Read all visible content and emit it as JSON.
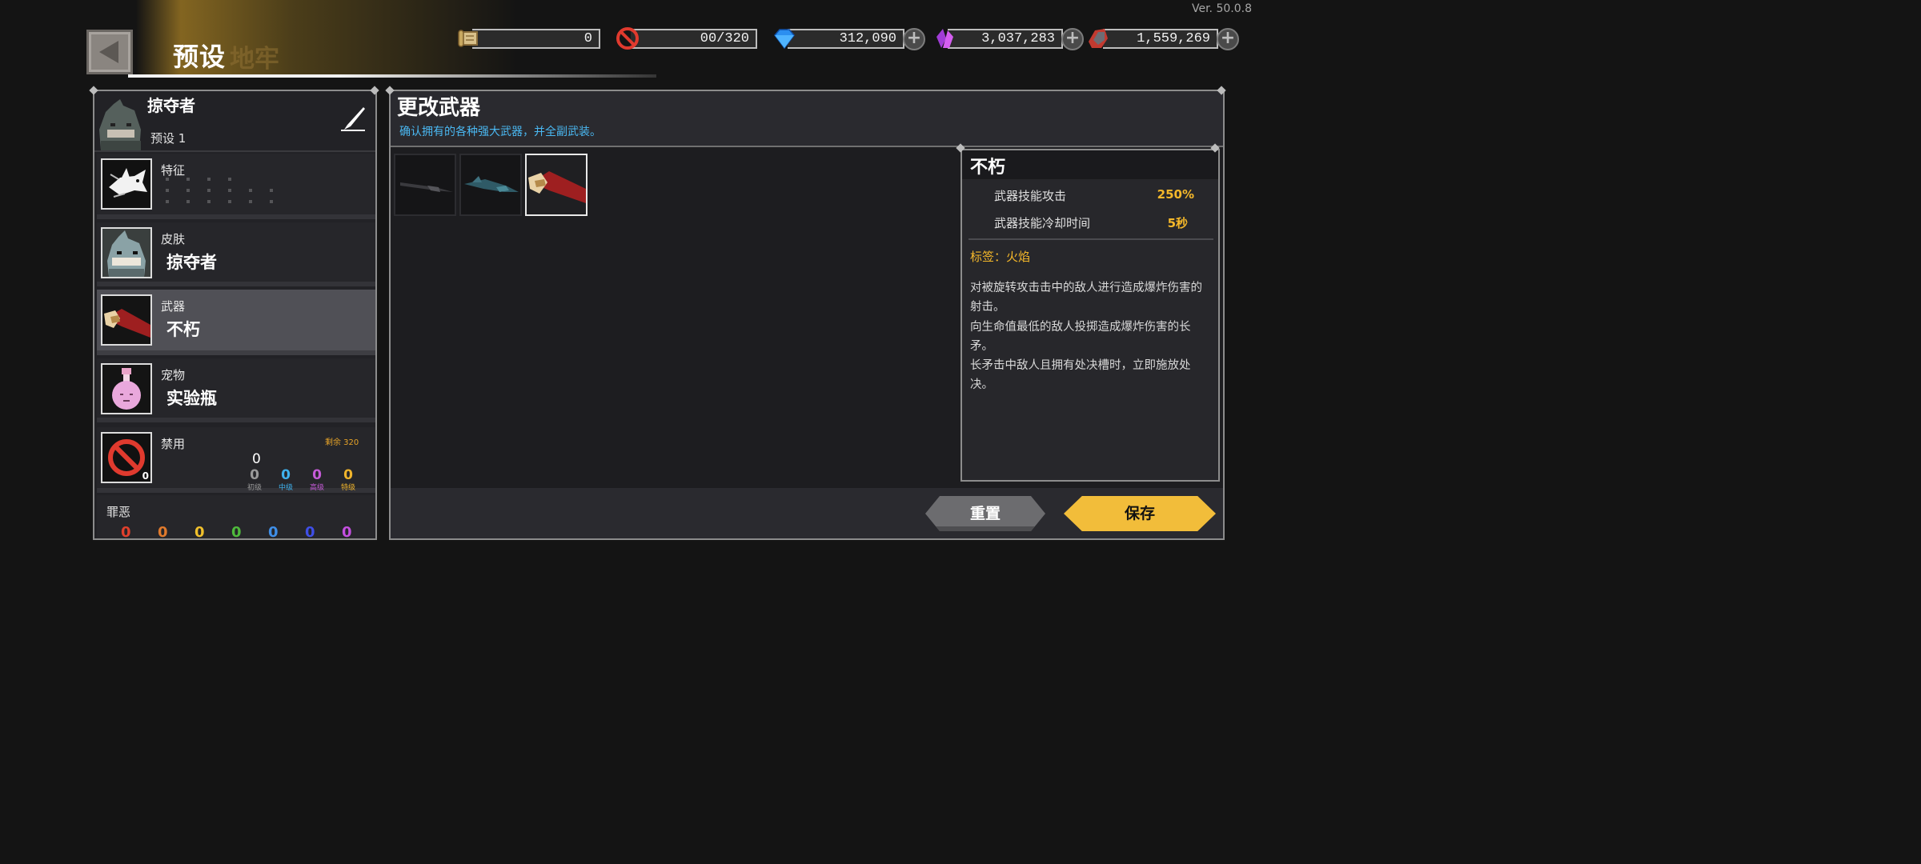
{
  "version": "Ver. 50.0.8",
  "header": {
    "title": "预设",
    "ghost_title": "地牢"
  },
  "resources": [
    {
      "icon": "scroll-icon",
      "value": "0"
    },
    {
      "icon": "ban-icon",
      "value": "00/320"
    },
    {
      "icon": "blue-gem-icon",
      "value": "312,090"
    },
    {
      "icon": "purple-crystal-icon",
      "value": "3,037,283"
    },
    {
      "icon": "dark-ore-icon",
      "value": "1,559,269"
    }
  ],
  "character": {
    "name": "掠夺者",
    "preset": "预设 1"
  },
  "slots": {
    "trait": {
      "label": "特征"
    },
    "skin": {
      "label": "皮肤",
      "value": "掠夺者"
    },
    "weapon": {
      "label": "武器",
      "value": "不朽"
    },
    "pet": {
      "label": "宠物",
      "value": "实验瓶"
    },
    "ban": {
      "label": "禁用",
      "count": "0",
      "remaining": "剩余 320",
      "total": "0",
      "levels": [
        {
          "value": "0",
          "name": "初级",
          "color": "#9a9a9a"
        },
        {
          "value": "0",
          "name": "中级",
          "color": "#3fb2ee"
        },
        {
          "value": "0",
          "name": "高级",
          "color": "#c65bd9"
        },
        {
          "value": "0",
          "name": "特级",
          "color": "#f0b42c"
        }
      ]
    },
    "sin": {
      "label": "罪恶",
      "values": [
        "0",
        "0",
        "0",
        "0",
        "0",
        "0",
        "0"
      ],
      "colors": [
        "#e0402c",
        "#e07a2c",
        "#f0c02c",
        "#4fba3c",
        "#3f8fe8",
        "#3f4fe8",
        "#c44fe0"
      ]
    }
  },
  "main": {
    "title": "更改武器",
    "subtitle": "确认拥有的各种强大武器，并全副武装。"
  },
  "detail": {
    "name": "不朽",
    "stats": [
      {
        "label": "武器技能攻击",
        "value": "250%"
      },
      {
        "label": "武器技能冷却时间",
        "value": "5秒"
      }
    ],
    "tag": "标签：火焰",
    "description": "对被旋转攻击击中的敌人进行造成爆炸伤害的射击。\n向生命值最低的敌人投掷造成爆炸伤害的长矛。\n长矛击中敌人且拥有处决槽时，立即施放处决。"
  },
  "buttons": {
    "reset": "重置",
    "save": "保存"
  }
}
